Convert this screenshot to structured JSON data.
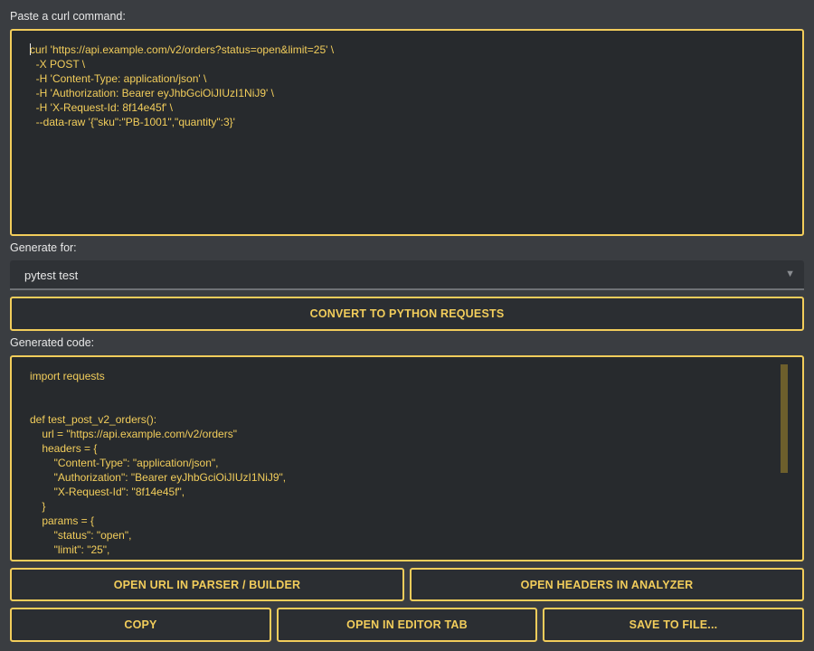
{
  "curl_section": {
    "label": "Paste a curl command:",
    "text": "url 'https://api.example.com/v2/orders?status=open&limit=25' \\\n  -X POST \\\n  -H 'Content-Type: application/json' \\\n  -H 'Authorization: Bearer eyJhbGciOiJIUzI1NiJ9' \\\n  -H 'X-Request-Id: 8f14e45f' \\\n  --data-raw '{\"sku\":\"PB-1001\",\"quantity\":3}'",
    "first_char": "c"
  },
  "generate_for": {
    "label": "Generate for:",
    "selected": "pytest test",
    "arrow": "▼"
  },
  "convert_button": "CONVERT TO PYTHON REQUESTS",
  "output_section": {
    "label": "Generated code:",
    "code": "import requests\n\n\ndef test_post_v2_orders():\n    url = \"https://api.example.com/v2/orders\"\n    headers = {\n        \"Content-Type\": \"application/json\",\n        \"Authorization\": \"Bearer eyJhbGciOiJIUzI1NiJ9\",\n        \"X-Request-Id\": \"8f14e45f\",\n    }\n    params = {\n        \"status\": \"open\",\n        \"limit\": \"25\",\n    }"
  },
  "actions": {
    "open_url": "OPEN URL IN PARSER / BUILDER",
    "open_headers": "OPEN HEADERS IN ANALYZER",
    "copy": "COPY",
    "open_editor": "OPEN IN EDITOR TAB",
    "save_file": "SAVE TO FILE..."
  },
  "colors": {
    "accent": "#f2cd5b",
    "background": "#3a3d41",
    "editor_bg": "#272a2d"
  }
}
